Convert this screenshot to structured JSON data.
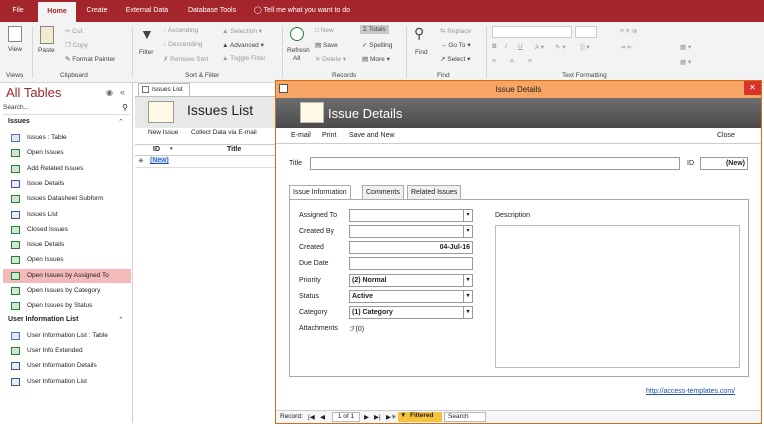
{
  "ribbon_tabs": [
    "File",
    "Home",
    "Create",
    "External Data",
    "Database Tools"
  ],
  "tell_me": "Tell me what you want to do",
  "groups": {
    "views": {
      "label": "Views",
      "view_btn": "View"
    },
    "clipboard": {
      "label": "Clipboard",
      "paste": "Paste",
      "cut": "Cut",
      "copy": "Copy",
      "format_painter": "Format Painter"
    },
    "sort_filter": {
      "label": "Sort & Filter",
      "filter": "Filter",
      "ascending": "Ascending",
      "descending": "Descending",
      "remove_sort": "Remove Sort",
      "selection": "Selection",
      "advanced": "Advanced",
      "toggle_filter": "Toggle Filter"
    },
    "records": {
      "label": "Records",
      "refresh": "Refresh",
      "refresh2": "All",
      "new": "New",
      "save": "Save",
      "delete": "Delete",
      "totals": "Totals",
      "spelling": "Spelling",
      "more": "More"
    },
    "find": {
      "label": "Find",
      "find": "Find",
      "replace": "Replace",
      "go_to": "Go To",
      "select": "Select"
    },
    "text_formatting": {
      "label": "Text Formatting",
      "bold": "B",
      "italic": "I",
      "underline": "U"
    }
  },
  "nav": {
    "title": "All Tables",
    "search": "Search...",
    "sections": [
      {
        "name": "Issues",
        "items": [
          {
            "label": "Issues : Table",
            "type": "table"
          },
          {
            "label": "Open Issues",
            "type": "form"
          },
          {
            "label": "Add Related Issues",
            "type": "form"
          },
          {
            "label": "Issue Details",
            "type": "rep"
          },
          {
            "label": "Issues Datasheet Subform",
            "type": "form"
          },
          {
            "label": "Issues List",
            "type": "rep"
          },
          {
            "label": "Closed Issues",
            "type": "form"
          },
          {
            "label": "Issue Details",
            "type": "form"
          },
          {
            "label": "Open Issues",
            "type": "form"
          },
          {
            "label": "Open Issues by Assigned To",
            "type": "form",
            "selected": true
          },
          {
            "label": "Open Issues by Category",
            "type": "form"
          },
          {
            "label": "Open Issues by Status",
            "type": "form"
          }
        ]
      },
      {
        "name": "User Information List",
        "items": [
          {
            "label": "User Information List : Table",
            "type": "table"
          },
          {
            "label": "User Info Extended",
            "type": "form"
          },
          {
            "label": "User Information Details",
            "type": "rep"
          },
          {
            "label": "User Information List",
            "type": "rep"
          }
        ]
      }
    ]
  },
  "issues_list": {
    "tab": "Issues List",
    "title": "Issues List",
    "new_issue": "New Issue",
    "collect": "Collect Data via E-mail",
    "col_id": "ID",
    "col_title": "Title",
    "new_row": "(New)"
  },
  "dialog": {
    "window_title": "Issue Details",
    "header_title": "Issue Details",
    "menu": {
      "email": "E-mail",
      "print": "Print",
      "save_new": "Save and New",
      "close": "Close"
    },
    "title_label": "Title",
    "id_label": "ID",
    "id_value": "(New)",
    "tabs": [
      "Issue Information",
      "Comments",
      "Related Issues"
    ],
    "fields": {
      "assigned_to": {
        "label": "Assigned To",
        "value": ""
      },
      "created_by": {
        "label": "Created By",
        "value": ""
      },
      "created": {
        "label": "Created",
        "value": "04-Jul-16"
      },
      "due_date": {
        "label": "Due Date",
        "value": ""
      },
      "priority": {
        "label": "Priority",
        "value": "(2) Normal"
      },
      "status": {
        "label": "Status",
        "value": "Active"
      },
      "category": {
        "label": "Category",
        "value": "(1) Category"
      },
      "attachments": {
        "label": "Attachments",
        "value": "(0)"
      }
    },
    "description_label": "Description",
    "link": "http://access-templates.com/",
    "record_nav": {
      "label": "Record:",
      "position": "1 of 1",
      "filtered": "Filtered",
      "search": "Search"
    }
  }
}
